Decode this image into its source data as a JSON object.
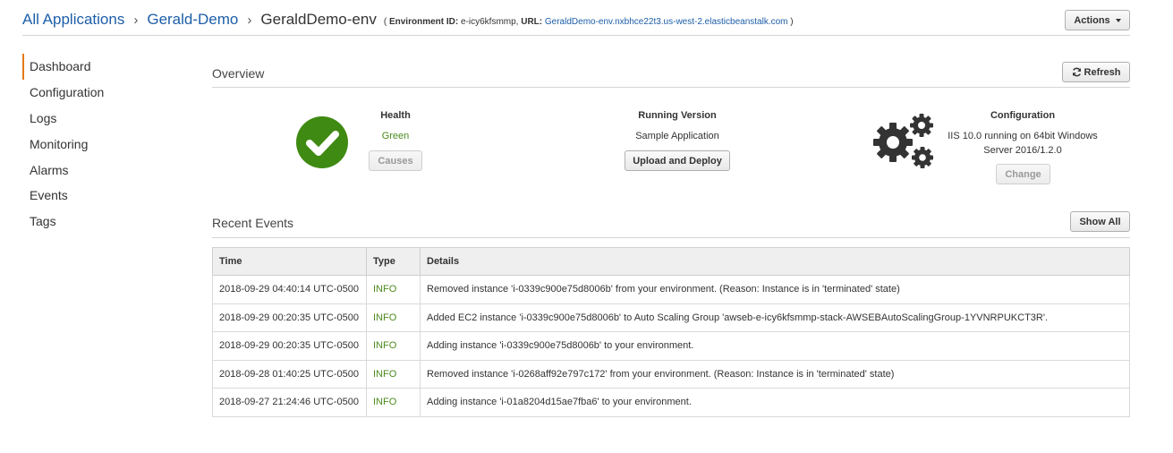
{
  "breadcrumb": {
    "app_root": "All Applications",
    "application": "Gerald-Demo",
    "environment": "GeraldDemo-env",
    "open_paren": "(",
    "env_id_label": "Environment ID:",
    "env_id": "e-icy6kfsmmp,",
    "url_label": "URL:",
    "url": "GeraldDemo-env.nxbhce22t3.us-west-2.elasticbeanstalk.com",
    "close_paren": ")"
  },
  "header": {
    "actions_label": "Actions"
  },
  "sidebar": {
    "items": [
      {
        "label": "Dashboard",
        "active": true
      },
      {
        "label": "Configuration"
      },
      {
        "label": "Logs"
      },
      {
        "label": "Monitoring"
      },
      {
        "label": "Alarms"
      },
      {
        "label": "Events"
      },
      {
        "label": "Tags"
      }
    ]
  },
  "overview": {
    "title": "Overview",
    "refresh_label": "Refresh",
    "health": {
      "heading": "Health",
      "value": "Green",
      "causes_label": "Causes",
      "color": "#3f8a12"
    },
    "running_version": {
      "heading": "Running Version",
      "value": "Sample Application",
      "button_label": "Upload and Deploy"
    },
    "configuration": {
      "heading": "Configuration",
      "line1": "IIS 10.0 running on 64bit Windows",
      "line2": "Server 2016/1.2.0",
      "change_label": "Change"
    }
  },
  "recent_events": {
    "title": "Recent Events",
    "show_all_label": "Show All",
    "columns": [
      "Time",
      "Type",
      "Details"
    ],
    "rows": [
      {
        "time": "2018-09-29 04:40:14 UTC-0500",
        "type": "INFO",
        "details": "Removed instance 'i-0339c900e75d8006b' from your environment. (Reason: Instance is in 'terminated' state)"
      },
      {
        "time": "2018-09-29 00:20:35 UTC-0500",
        "type": "INFO",
        "details": "Added EC2 instance 'i-0339c900e75d8006b' to Auto Scaling Group 'awseb-e-icy6kfsmmp-stack-AWSEBAutoScalingGroup-1YVNRPUKCT3R'."
      },
      {
        "time": "2018-09-29 00:20:35 UTC-0500",
        "type": "INFO",
        "details": "Adding instance 'i-0339c900e75d8006b' to your environment."
      },
      {
        "time": "2018-09-28 01:40:25 UTC-0500",
        "type": "INFO",
        "details": "Removed instance 'i-0268aff92e797c172' from your environment. (Reason: Instance is in 'terminated' state)"
      },
      {
        "time": "2018-09-27 21:24:46 UTC-0500",
        "type": "INFO",
        "details": "Adding instance 'i-01a8204d15ae7fba6' to your environment."
      }
    ]
  },
  "icons": {
    "health": "checkmark-circle-icon",
    "configuration": "gears-icon",
    "refresh": "refresh-icon",
    "actions": "caret-down-icon"
  }
}
